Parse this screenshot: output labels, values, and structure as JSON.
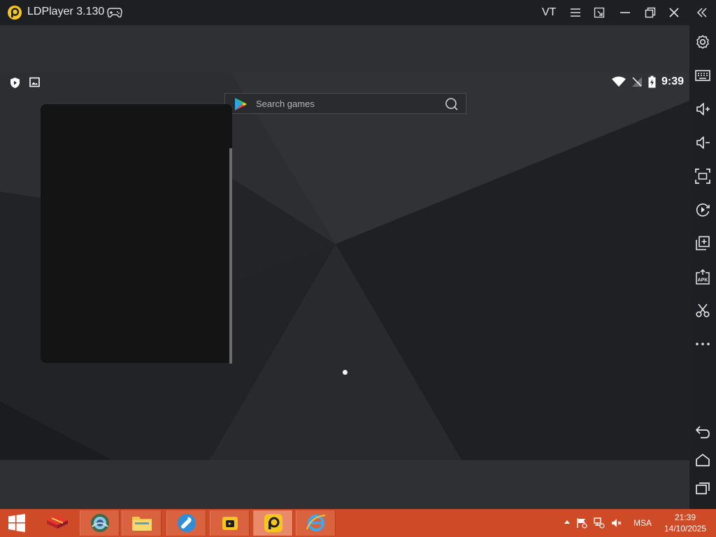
{
  "app": {
    "title": "LDPlayer 3.130",
    "vt_label": "VT"
  },
  "android": {
    "clock": "9:39",
    "search_placeholder": "Search games"
  },
  "right_toolbar": {
    "items": [
      "settings",
      "keyboard",
      "volume-up",
      "volume-down",
      "fullscreen",
      "operation-record",
      "multi-instance",
      "install-apk",
      "scissors",
      "more"
    ],
    "nav": [
      "back",
      "home",
      "recent-apps"
    ]
  },
  "taskbar": {
    "language": "MSA",
    "time": "21:39",
    "date": "14/10/2025",
    "apps": [
      "winrar",
      "photo-viewer",
      "file-explorer",
      "repair-tool",
      "multi-player",
      "ldplayer",
      "internet-explorer"
    ]
  },
  "colors": {
    "titlebar": "#1e1f22",
    "taskbar": "#cf4b27",
    "accent_ldplayer": "#f7c520"
  }
}
